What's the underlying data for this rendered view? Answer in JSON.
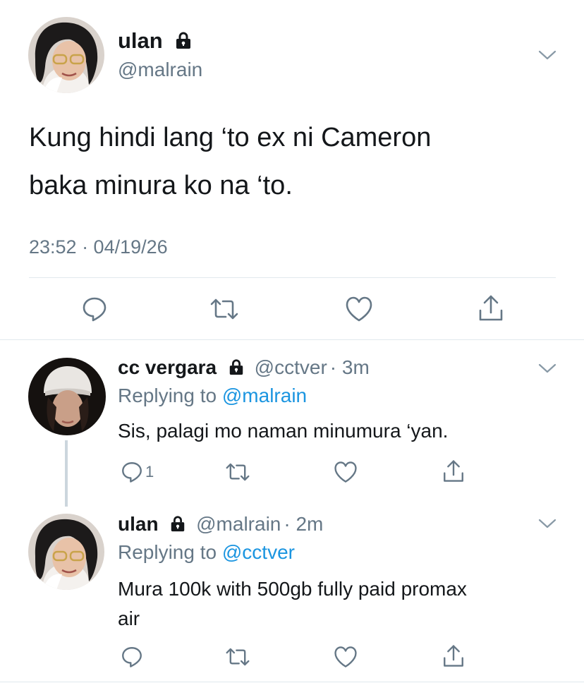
{
  "main_tweet": {
    "display_name": "ulan",
    "handle": "@malrain",
    "text_line1": "Kung hindi lang ‘to ex ni Cameron",
    "text_line2": "baka minura ko na ‘to.",
    "timestamp": "23:52 · 04/19/26",
    "icons": [
      "lock-icon",
      "chevron-down-icon",
      "reply-icon",
      "retweet-icon",
      "like-icon",
      "share-icon"
    ]
  },
  "replies": [
    {
      "display_name": "cc vergara",
      "handle": "@cctver",
      "time": "· 3m",
      "replying_prefix": "Replying to",
      "replying_to": "@malrain",
      "text": "Sis, palagi mo naman minumura ‘yan.",
      "reply_count": "1"
    },
    {
      "display_name": "ulan",
      "handle": "@malrain",
      "time": "· 2m",
      "replying_prefix": "Replying to",
      "replying_to": "@cctver",
      "text_line1": "Mura 100k with 500gb fully paid promax",
      "text_line2": "air",
      "reply_count": ""
    }
  ],
  "colors": {
    "text": "#14171a",
    "secondary": "#657786",
    "link": "#1b95e0",
    "divider": "#e1e8ed"
  }
}
